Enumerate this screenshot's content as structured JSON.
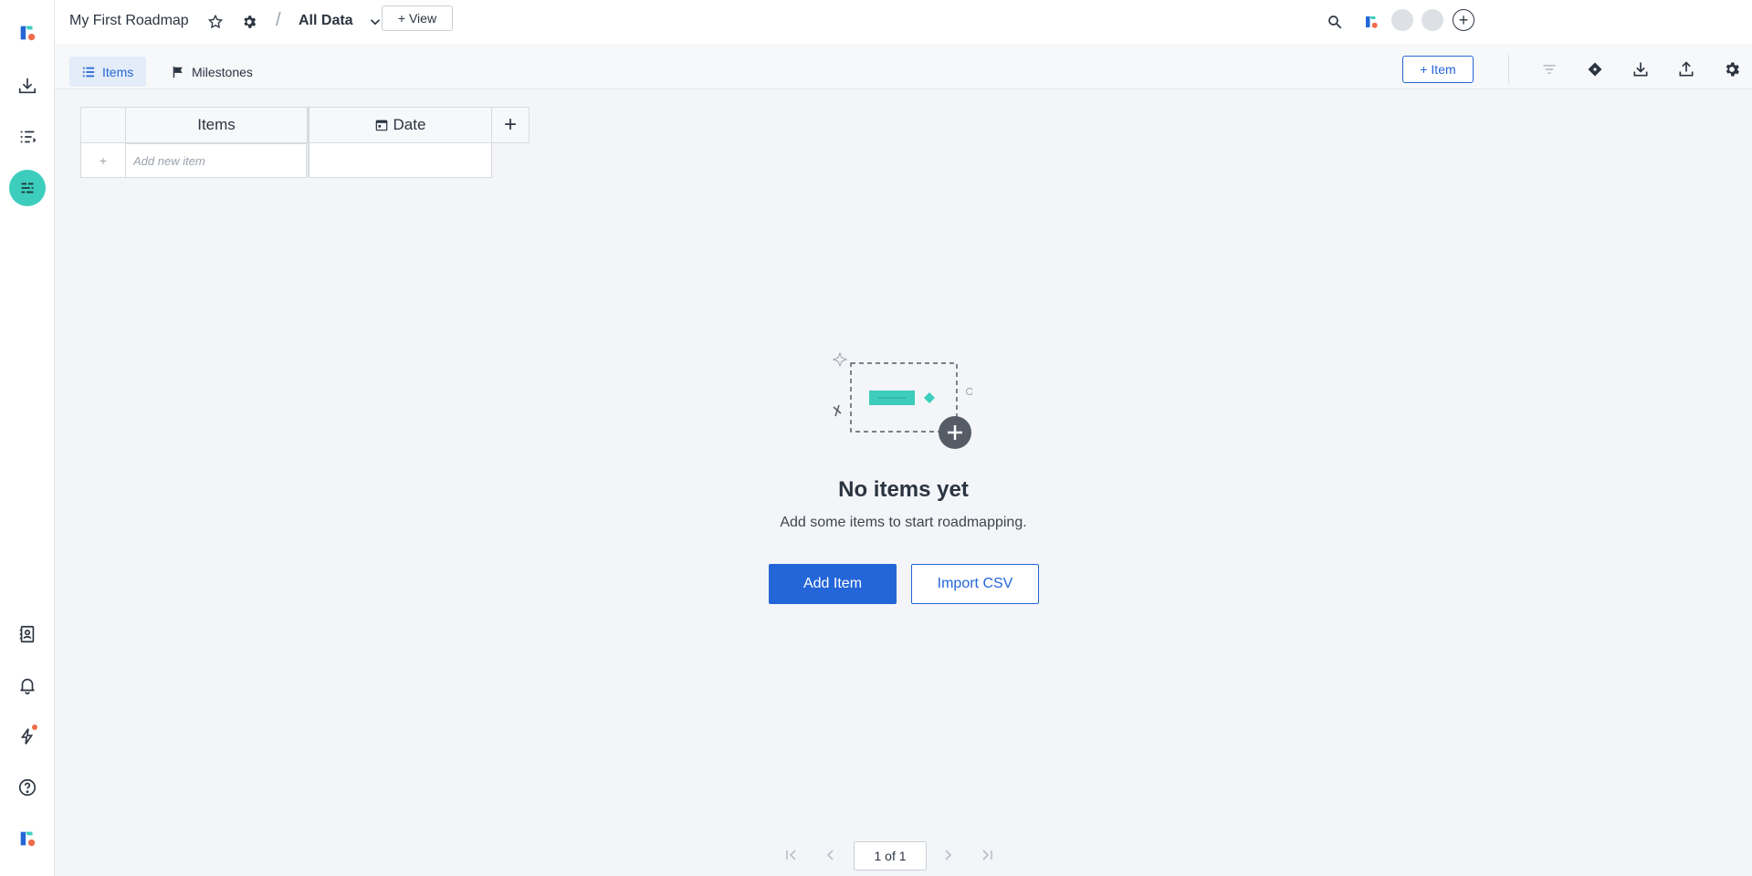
{
  "brand": {
    "logo_icon": "roadmunk-logo-icon",
    "accent_color": "#f06c4a"
  },
  "header": {
    "roadmap_title": "My First Roadmap",
    "separator": "/",
    "view_name": "All Data",
    "new_view_label": "+ View"
  },
  "sidebar": {
    "items": [
      {
        "name": "inbox",
        "icon": "inbox-download-icon"
      },
      {
        "name": "items-list",
        "icon": "list-icon"
      },
      {
        "name": "roadmap",
        "icon": "roadmap-icon",
        "active": true
      },
      {
        "name": "contacts",
        "icon": "contacts-icon"
      },
      {
        "name": "notifications",
        "icon": "bell-icon"
      },
      {
        "name": "whats-new",
        "icon": "lightning-icon"
      },
      {
        "name": "help",
        "icon": "help-icon"
      }
    ]
  },
  "toolbar": {
    "tabs": [
      {
        "label": "Items",
        "icon": "list-icon",
        "active": true
      },
      {
        "label": "Milestones",
        "icon": "flag-icon",
        "active": false
      }
    ],
    "add_item_label": "+ Item"
  },
  "grid": {
    "columns": [
      {
        "label": "Items"
      },
      {
        "label": "Date",
        "icon": "calendar-icon"
      }
    ],
    "add_column_label": "+",
    "add_row_symbol": "+",
    "new_item_placeholder": "Add new item"
  },
  "empty_state": {
    "title": "No items yet",
    "subtitle": "Add some items to start roadmapping.",
    "primary_action": "Add Item",
    "secondary_action": "Import CSV"
  },
  "pagination": {
    "indicator": "1 of 1"
  },
  "colors": {
    "primary": "#2466d8",
    "teal": "#3dcdbd",
    "text": "#2b3440",
    "background": "#f3f5f8"
  }
}
